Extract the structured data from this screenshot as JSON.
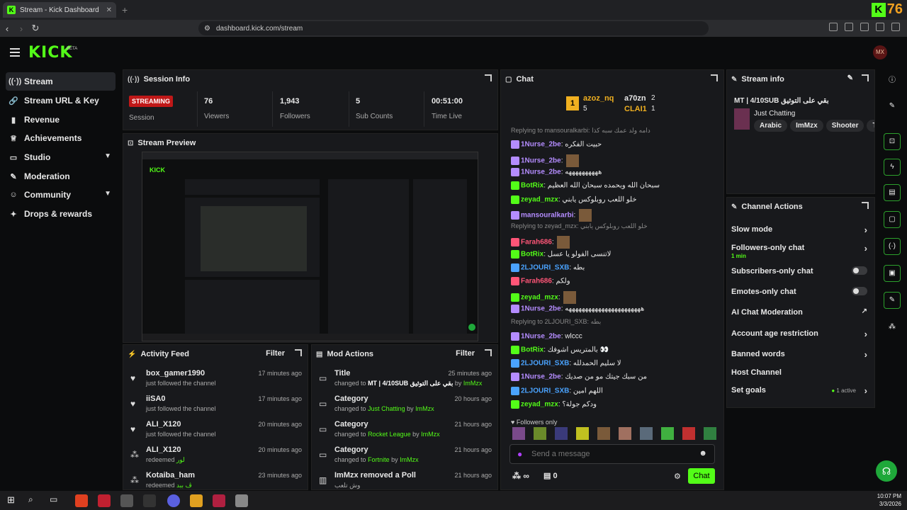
{
  "browser": {
    "tab_title": "Stream - Kick Dashboard",
    "tab_close": "✕",
    "new_tab": "+",
    "url": "dashboard.kick.com/stream",
    "corner_logo": "K",
    "corner_count": "76"
  },
  "header": {
    "logo": "KICK",
    "beta": "BETA",
    "avatar_text": "MX"
  },
  "sidebar": {
    "items": [
      {
        "label": "Stream",
        "icon": "stream-icon"
      },
      {
        "label": "Stream URL & Key",
        "icon": "link-icon"
      },
      {
        "label": "Revenue",
        "icon": "revenue-icon"
      },
      {
        "label": "Achievements",
        "icon": "trophy-icon"
      },
      {
        "label": "Studio",
        "icon": "studio-icon"
      },
      {
        "label": "Moderation",
        "icon": "wrench-icon"
      },
      {
        "label": "Community",
        "icon": "community-icon"
      },
      {
        "label": "Drops & rewards",
        "icon": "drops-icon"
      }
    ]
  },
  "session": {
    "title": "Session Info",
    "status": "STREAMING",
    "status_label": "Session",
    "stats": [
      {
        "value": "76",
        "label": "Viewers"
      },
      {
        "value": "1,943",
        "label": "Followers"
      },
      {
        "value": "5",
        "label": "Sub Counts"
      },
      {
        "value": "00:51:00",
        "label": "Time Live"
      }
    ]
  },
  "preview": {
    "title": "Stream Preview"
  },
  "activity": {
    "title": "Activity Feed",
    "filter": "Filter",
    "items": [
      {
        "name": "box_gamer1990",
        "desc": "just followed the channel",
        "extra": "",
        "time": "17 minutes ago",
        "icon": "heart-icon"
      },
      {
        "name": "iiSA0",
        "desc": "just followed the channel",
        "extra": "",
        "time": "17 minutes ago",
        "icon": "heart-icon"
      },
      {
        "name": "ALI_X120",
        "desc": "just followed the channel",
        "extra": "",
        "time": "20 minutes ago",
        "icon": "heart-icon"
      },
      {
        "name": "ALI_X120",
        "desc": "redeemed",
        "extra": "لور",
        "time": "20 minutes ago",
        "icon": "reward-icon"
      },
      {
        "name": "Kotaiba_ham",
        "desc": "redeemed",
        "extra": "ڤ ببد",
        "time": "23 minutes ago",
        "icon": "reward-icon"
      }
    ]
  },
  "mod": {
    "title": "Mod Actions",
    "filter": "Filter",
    "items": [
      {
        "title": "Title",
        "pre": "changed to",
        "val": "MT | 4/10SUB بقي على التوثيق",
        "by": "by",
        "user": "ImMzx",
        "time": "25 minutes ago"
      },
      {
        "title": "Category",
        "pre": "changed to",
        "val": "Just Chatting",
        "by": "by",
        "user": "ImMzx",
        "time": "20 hours ago"
      },
      {
        "title": "Category",
        "pre": "changed to",
        "val": "Rocket League",
        "by": "by",
        "user": "ImMzx",
        "time": "21 hours ago"
      },
      {
        "title": "Category",
        "pre": "changed to",
        "val": "Fortnite",
        "by": "by",
        "user": "ImMzx",
        "time": "21 hours ago"
      },
      {
        "title": "ImMzx removed a Poll",
        "pre": "وش تلعب",
        "val": "",
        "by": "",
        "user": "",
        "time": "21 hours ago"
      }
    ]
  },
  "chat": {
    "title": "Chat",
    "top": [
      {
        "rank": "1",
        "name": "azoz_nq",
        "count": "5"
      },
      {
        "name": "a70zn",
        "count": "2"
      },
      {
        "name": "CLAI1",
        "count": "1"
      }
    ],
    "messages": [
      {
        "reply": "Replying to mansouralkarbi: دامه ولد عمك سبه كذا"
      },
      {
        "user": "1Nurse_2be",
        "color": "#b48cff",
        "text": "حبيت الفكره"
      },
      {
        "user": "1Nurse_2be",
        "color": "#b48cff",
        "text": "",
        "emote": true
      },
      {
        "user": "1Nurse_2be",
        "color": "#b48cff",
        "text": "ههههههههههه"
      },
      {
        "user": "BotRix",
        "color": "#53fc18",
        "text": "سبحان الله وبحمده سبحان الله العظيم"
      },
      {
        "user": "zeyad_mzx",
        "color": "#53fc18",
        "text": "خلو اللعب روبلوكس يابني"
      },
      {
        "user": "mansouralkarbi",
        "color": "#b48cff",
        "text": "",
        "emote": true
      },
      {
        "reply": "Replying to zeyad_mzx: خلو اللعب روبلوكس يابني"
      },
      {
        "user": "Farah686",
        "color": "#ff5577",
        "text": "",
        "emote": true
      },
      {
        "user": "BotRix",
        "color": "#53fc18",
        "text": "لاتنسى الفولو يا عسل"
      },
      {
        "user": "2LJOURI_SXB",
        "color": "#4aa3ff",
        "text": "بطه"
      },
      {
        "user": "Farah686",
        "color": "#ff5577",
        "text": "ولكم"
      },
      {
        "user": "zeyad_mzx",
        "color": "#53fc18",
        "text": "",
        "emote": true
      },
      {
        "user": "1Nurse_2be",
        "color": "#b48cff",
        "text": "هههههههههههههههههههههههه"
      },
      {
        "reply": "Replying to 2LJOURI_SXB: بطه"
      },
      {
        "user": "1Nurse_2be",
        "color": "#b48cff",
        "text": "wlccc"
      },
      {
        "user": "BotRix",
        "color": "#53fc18",
        "text": "بالمتريس اشوفك 👀"
      },
      {
        "user": "2LJOURI_SXB",
        "color": "#4aa3ff",
        "text": "لا سليم الحمدلله"
      },
      {
        "user": "1Nurse_2be",
        "color": "#b48cff",
        "text": "من سبك جيتك مو من صديك"
      },
      {
        "user": "2LJOURI_SXB",
        "color": "#4aa3ff",
        "text": "اللهم امين"
      },
      {
        "user": "zeyad_mzx",
        "color": "#53fc18",
        "text": "ودكم جولة؟"
      }
    ],
    "followers_only": "Followers only",
    "placeholder": "Send a message",
    "points": "∞",
    "gift_count": "0",
    "send": "Chat"
  },
  "stream_info": {
    "title": "Stream info",
    "stream_title": "MT | 4/10SUB بقي على التوثيق",
    "category": "Just Chatting",
    "tags": [
      "Arabic",
      "ImMzx",
      "Shooter",
      "TRO"
    ]
  },
  "actions": {
    "title": "Channel Actions",
    "items": [
      {
        "label": "Slow mode",
        "sub": "",
        "control": "arrow"
      },
      {
        "label": "Followers-only chat",
        "sub": "1 min",
        "control": "arrow"
      },
      {
        "label": "Subscribers-only chat",
        "sub": "",
        "control": "toggle"
      },
      {
        "label": "Emotes-only chat",
        "sub": "",
        "control": "toggle"
      },
      {
        "label": "AI Chat Moderation",
        "sub": "",
        "control": "external"
      },
      {
        "label": "Account age restriction",
        "sub": "",
        "control": "arrow"
      },
      {
        "label": "Banned words",
        "sub": "",
        "control": "arrow"
      },
      {
        "label": "Host Channel",
        "sub": "",
        "control": "none"
      },
      {
        "label": "Set goals",
        "sub": "",
        "status": "1 active",
        "control": "arrow"
      }
    ]
  },
  "clock": {
    "time": "10:07 PM",
    "date": "3/3/2026"
  }
}
